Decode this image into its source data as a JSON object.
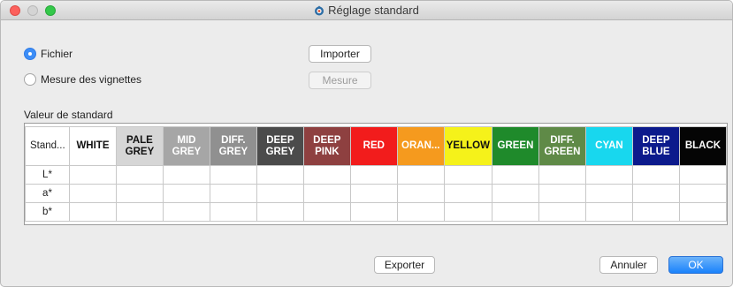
{
  "window": {
    "title": "Réglage standard"
  },
  "options": {
    "file_label": "Fichier",
    "file_selected": true,
    "measure_label": "Mesure des vignettes",
    "measure_selected": false
  },
  "buttons": {
    "import": "Importer",
    "measure": "Mesure",
    "export": "Exporter",
    "cancel": "Annuler",
    "ok": "OK"
  },
  "standard": {
    "section_label": "Valeur de standard",
    "corner_header": "Stand...",
    "columns": [
      {
        "label": "WHITE",
        "bg": "#ffffff",
        "fg": "#111111"
      },
      {
        "label": "PALE\nGREY",
        "bg": "#d6d6d6",
        "fg": "#111111"
      },
      {
        "label": "MID\nGREY",
        "bg": "#a6a6a6",
        "fg": "#ffffff"
      },
      {
        "label": "DIFF.\nGREY",
        "bg": "#909090",
        "fg": "#ffffff"
      },
      {
        "label": "DEEP\nGREY",
        "bg": "#4b4b4b",
        "fg": "#ffffff"
      },
      {
        "label": "DEEP\nPINK",
        "bg": "#8e4040",
        "fg": "#ffffff"
      },
      {
        "label": "RED",
        "bg": "#f21c1c",
        "fg": "#ffffff"
      },
      {
        "label": "ORAN...",
        "bg": "#f59a1e",
        "fg": "#ffffff"
      },
      {
        "label": "YELLOW",
        "bg": "#f5f21a",
        "fg": "#111111"
      },
      {
        "label": "GREEN",
        "bg": "#1f8a2b",
        "fg": "#ffffff"
      },
      {
        "label": "DIFF.\nGREEN",
        "bg": "#5f8a47",
        "fg": "#ffffff"
      },
      {
        "label": "CYAN",
        "bg": "#18d7ee",
        "fg": "#ffffff"
      },
      {
        "label": "DEEP\nBLUE",
        "bg": "#0c1a8c",
        "fg": "#ffffff"
      },
      {
        "label": "BLACK",
        "bg": "#050505",
        "fg": "#ffffff"
      }
    ],
    "rows": [
      "L*",
      "a*",
      "b*"
    ]
  }
}
